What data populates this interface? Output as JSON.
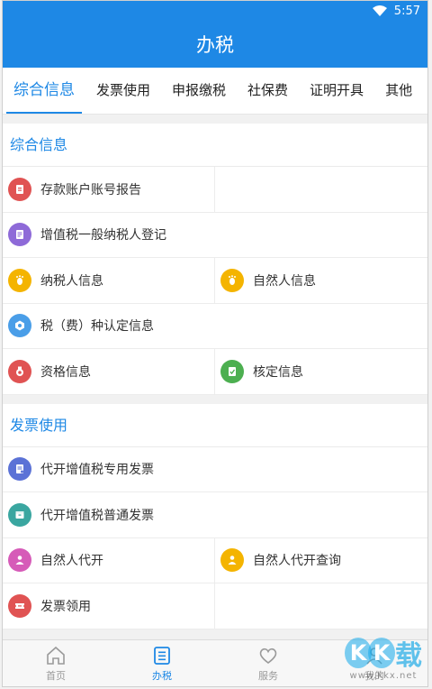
{
  "status": {
    "time": "5:57"
  },
  "appbar": {
    "title": "办税"
  },
  "tabs": [
    {
      "label": "综合信息"
    },
    {
      "label": "发票使用"
    },
    {
      "label": "申报缴税"
    },
    {
      "label": "社保费"
    },
    {
      "label": "证明开具"
    },
    {
      "label": "其他"
    }
  ],
  "sections": [
    {
      "title": "综合信息",
      "items": [
        {
          "label": "存款账户账号报告",
          "color": "#e05353"
        },
        {
          "label": "增值税一般纳税人登记",
          "color": "#8e6ad8"
        },
        {
          "label": "纳税人信息",
          "color": "#f4b400"
        },
        {
          "label": "自然人信息",
          "color": "#f4b400"
        },
        {
          "label": "税（费）种认定信息",
          "color": "#4a9ee8"
        },
        {
          "label": "资格信息",
          "color": "#e05353"
        },
        {
          "label": "核定信息",
          "color": "#4caf50"
        }
      ]
    },
    {
      "title": "发票使用",
      "items": [
        {
          "label": "代开增值税专用发票",
          "color": "#5b72d6"
        },
        {
          "label": "代开增值税普通发票",
          "color": "#3aa6a0"
        },
        {
          "label": "自然人代开",
          "color": "#d65bb8"
        },
        {
          "label": "自然人代开查询",
          "color": "#f4b400"
        },
        {
          "label": "发票领用",
          "color": "#e05353"
        }
      ]
    }
  ],
  "bottom_nav": [
    {
      "label": "首页"
    },
    {
      "label": "办税"
    },
    {
      "label": "服务"
    },
    {
      "label": "我的"
    }
  ],
  "watermark": {
    "brand": "KK下载",
    "url": "www.kkx.net"
  },
  "colors": {
    "primary": "#1e88e5"
  }
}
